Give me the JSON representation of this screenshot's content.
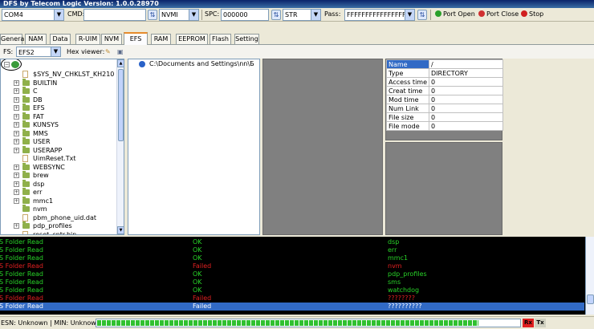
{
  "window": {
    "title": "DFS by Telecom Logic  Version: 1.0.0.28970"
  },
  "toolbar": {
    "com_port": "COM4",
    "cmd_label": "CMD:",
    "cmd_value": "",
    "nvmi_value": "NVMI",
    "spc_label": "SPC:",
    "spc_value": "000000",
    "str_value": "STR",
    "pass_label": "Pass:",
    "pass_value": "FFFFFFFFFFFFFFFF",
    "port_open_label": "Port Open",
    "port_close_label": "Port Close",
    "stop_label": "Stop"
  },
  "tabs": [
    {
      "label": "General"
    },
    {
      "label": "NAM"
    },
    {
      "label": "Data"
    },
    {
      "label": "R-UIM"
    },
    {
      "label": "NVM"
    },
    {
      "label": "EFS"
    },
    {
      "label": "RAM"
    },
    {
      "label": "EEPROM"
    },
    {
      "label": "Flash"
    },
    {
      "label": "Setting"
    }
  ],
  "active_tab": "EFS",
  "fs_bar": {
    "fs_label": "FS:",
    "fs_value": "EFS2",
    "hex_viewer_label": "Hex viewer:"
  },
  "tree": {
    "items": [
      {
        "label": "$SYS_NV_CHKLST_KH210",
        "type": "file",
        "expandable": false
      },
      {
        "label": "BUILTIN",
        "type": "folder",
        "expandable": true
      },
      {
        "label": "C",
        "type": "folder",
        "expandable": true
      },
      {
        "label": "DB",
        "type": "folder",
        "expandable": true
      },
      {
        "label": "EFS",
        "type": "folder",
        "expandable": true
      },
      {
        "label": "FAT",
        "type": "folder",
        "expandable": true
      },
      {
        "label": "KUNSYS",
        "type": "folder",
        "expandable": true
      },
      {
        "label": "MMS",
        "type": "folder",
        "expandable": true
      },
      {
        "label": "USER",
        "type": "folder",
        "expandable": true
      },
      {
        "label": "USERAPP",
        "type": "folder",
        "expandable": true
      },
      {
        "label": "UimReset.Txt",
        "type": "file",
        "expandable": false
      },
      {
        "label": "WEBSYNC",
        "type": "folder",
        "expandable": true
      },
      {
        "label": "brew",
        "type": "folder",
        "expandable": true
      },
      {
        "label": "dsp",
        "type": "folder",
        "expandable": true
      },
      {
        "label": "err",
        "type": "folder",
        "expandable": true
      },
      {
        "label": "mmc1",
        "type": "folder",
        "expandable": true
      },
      {
        "label": "nvm",
        "type": "folder",
        "expandable": false
      },
      {
        "label": "pbm_phone_uid.dat",
        "type": "file",
        "expandable": false
      },
      {
        "label": "pdp_profiles",
        "type": "folder",
        "expandable": true
      },
      {
        "label": "reset_cntr.bin",
        "type": "file",
        "expandable": false
      }
    ]
  },
  "path_panel": {
    "path": "C:\\Documents and Settings\\nn\\Б"
  },
  "properties": [
    {
      "key": "Name",
      "value": "/"
    },
    {
      "key": "Type",
      "value": "DIRECTORY"
    },
    {
      "key": "Access time",
      "value": "0"
    },
    {
      "key": "Creat time",
      "value": "0"
    },
    {
      "key": "Mod time",
      "value": "0"
    },
    {
      "key": "Num Link",
      "value": "0"
    },
    {
      "key": "File size",
      "value": "0"
    },
    {
      "key": "File mode",
      "value": "0"
    }
  ],
  "log": [
    {
      "action": "S Folder Read",
      "status": "OK",
      "item": "dsp",
      "ok": true
    },
    {
      "action": "S Folder Read",
      "status": "OK",
      "item": "err",
      "ok": true
    },
    {
      "action": "S Folder Read",
      "status": "OK",
      "item": "mmc1",
      "ok": true
    },
    {
      "action": "S Folder Read",
      "status": "Failed",
      "item": "nvm",
      "ok": false
    },
    {
      "action": "S Folder Read",
      "status": "OK",
      "item": "pdp_profiles",
      "ok": true
    },
    {
      "action": "S Folder Read",
      "status": "OK",
      "item": "sms",
      "ok": true
    },
    {
      "action": "S Folder Read",
      "status": "OK",
      "item": "watchdog",
      "ok": true
    },
    {
      "action": "S Folder Read",
      "status": "Failed",
      "item": "????????",
      "ok": false
    },
    {
      "action": "S Folder Read",
      "status": "Failed",
      "item": "??????????",
      "ok": false,
      "selected": true
    }
  ],
  "status": {
    "text": "ESN: Unknown  |  MIN: Unknown",
    "progress": 0.9,
    "rx_label": "Rx",
    "tx_label": "Tx"
  },
  "colors": {
    "log_ok": "#28d228",
    "log_failed": "#e02020",
    "selection": "#316ac5",
    "active_tab_accent": "#e68b2c"
  }
}
